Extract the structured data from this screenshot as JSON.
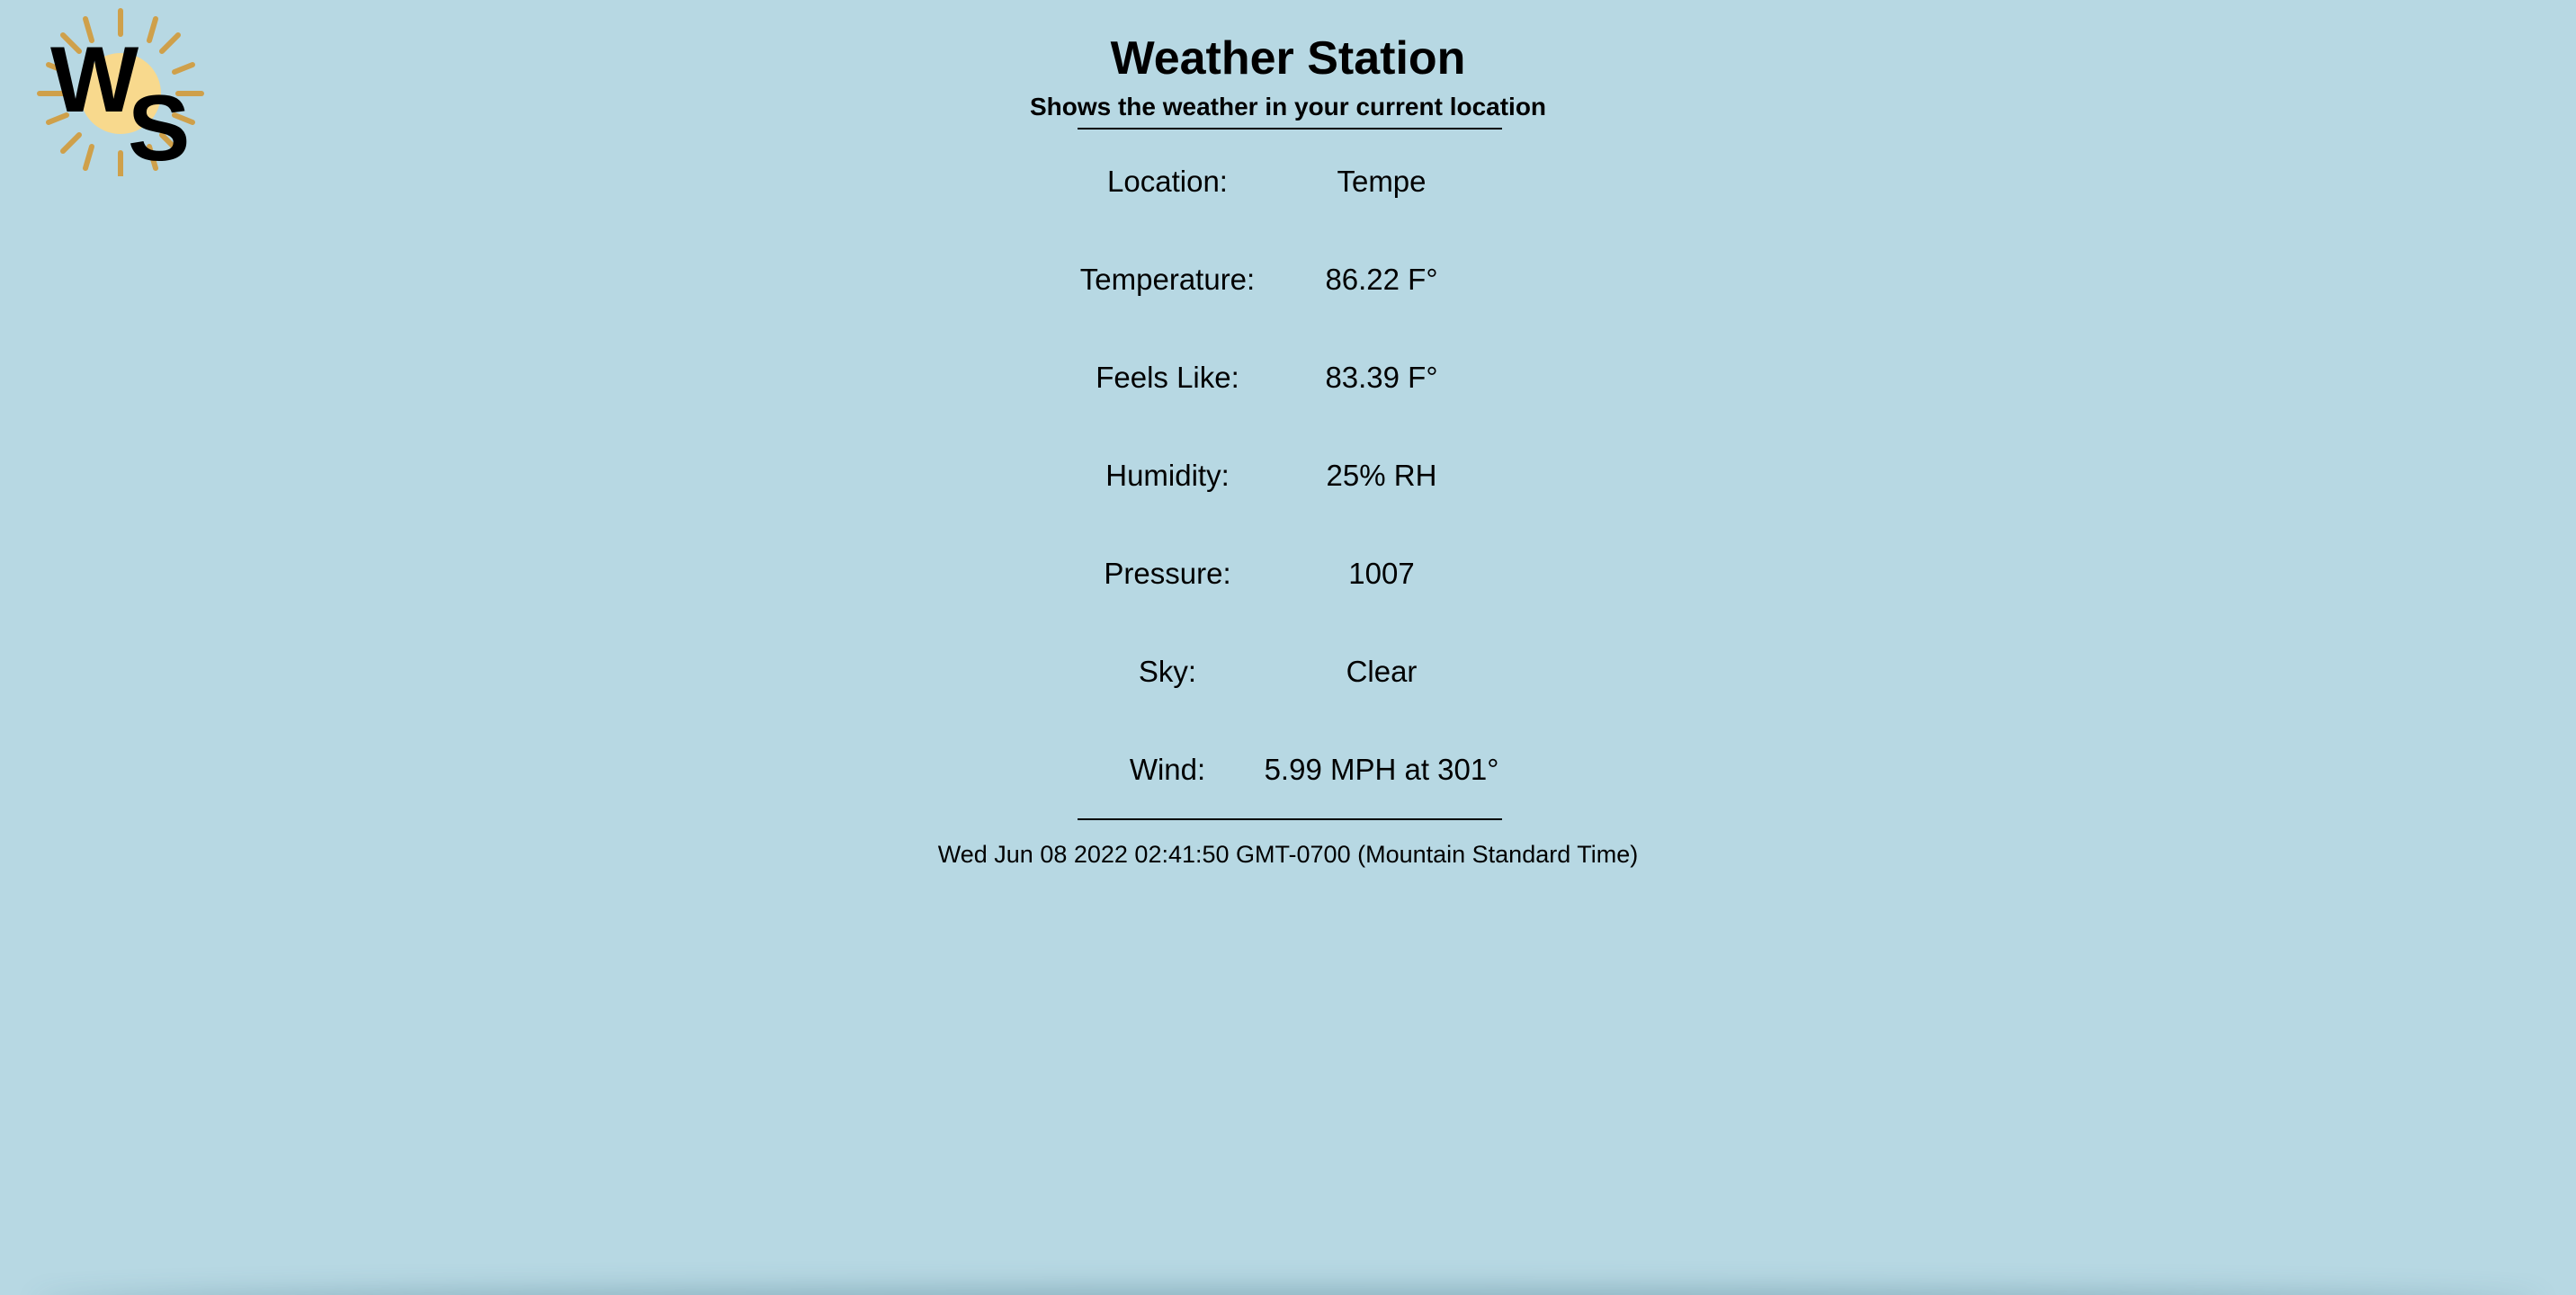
{
  "logo": {
    "letters": "WS",
    "sun_color": "#f8d98d",
    "ray_color": "#cfa04a"
  },
  "header": {
    "title": "Weather Station",
    "subtitle": "Shows the weather in your current location"
  },
  "weather": {
    "rows": [
      {
        "label": "Location:",
        "value": "Tempe"
      },
      {
        "label": "Temperature:",
        "value": "86.22 F°"
      },
      {
        "label": "Feels Like:",
        "value": "83.39 F°"
      },
      {
        "label": "Humidity:",
        "value": "25% RH"
      },
      {
        "label": "Pressure:",
        "value": "1007"
      },
      {
        "label": "Sky:",
        "value": "Clear"
      },
      {
        "label": "Wind:",
        "value": "5.99 MPH at 301°"
      }
    ]
  },
  "footer": {
    "timestamp": "Wed Jun 08 2022 02:41:50 GMT-0700 (Mountain Standard Time)"
  },
  "colors": {
    "background": "#b7d8e3",
    "text": "#000000"
  }
}
